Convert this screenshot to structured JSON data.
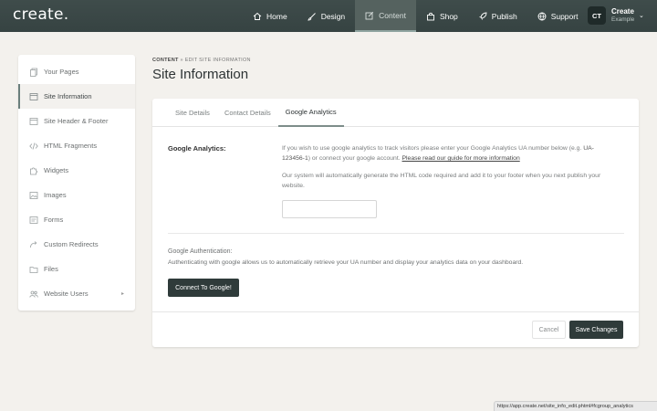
{
  "app": {
    "logo": "create."
  },
  "nav": {
    "items": [
      {
        "label": "Home",
        "icon": "home-icon"
      },
      {
        "label": "Design",
        "icon": "brush-icon"
      },
      {
        "label": "Content",
        "icon": "edit-icon",
        "active": true
      },
      {
        "label": "Shop",
        "icon": "shop-icon"
      },
      {
        "label": "Publish",
        "icon": "rocket-icon"
      },
      {
        "label": "Support",
        "icon": "globe-icon"
      }
    ]
  },
  "account": {
    "initials": "CT",
    "name": "Create",
    "sub": "Example"
  },
  "sidebar": {
    "items": [
      {
        "label": "Your Pages",
        "icon": "pages-icon"
      },
      {
        "label": "Site Information",
        "icon": "browser-icon",
        "active": true
      },
      {
        "label": "Site Header & Footer",
        "icon": "browser-icon"
      },
      {
        "label": "HTML Fragments",
        "icon": "code-icon"
      },
      {
        "label": "Widgets",
        "icon": "puzzle-icon"
      },
      {
        "label": "Images",
        "icon": "image-icon"
      },
      {
        "label": "Forms",
        "icon": "form-icon"
      },
      {
        "label": "Custom Redirects",
        "icon": "redirect-icon"
      },
      {
        "label": "Files",
        "icon": "folder-icon"
      },
      {
        "label": "Website Users",
        "icon": "users-icon"
      }
    ]
  },
  "breadcrumb": {
    "first": "CONTENT",
    "sep": "»",
    "second": "EDIT SITE INFORMATION"
  },
  "page": {
    "title": "Site Information"
  },
  "tabs": [
    {
      "label": "Site Details"
    },
    {
      "label": "Contact Details"
    },
    {
      "label": "Google Analytics",
      "active": true
    }
  ],
  "form": {
    "ga_label": "Google Analytics:",
    "ga_text_before": "If you wish to use google analytics to track visitors please enter your Google Analytics UA number below (e.g. ",
    "ga_example": "UA-123456-1",
    "ga_text_after": ") or connect your google account. ",
    "ga_link": "Please read our guide for more information",
    "ga_text2": "Our system will automatically generate the HTML code required and add it to your footer when you next publish your website.",
    "ua_value": "",
    "auth_title": "Google Authentication:",
    "auth_text": "Authenticating with google allows us to automatically retrieve your UA number and display your analytics data on your dashboard.",
    "connect_label": "Connect To Google!"
  },
  "footer": {
    "cancel_label": "Cancel",
    "save_label": "Save Changes"
  },
  "status_bar": {
    "url": "https://app.create.net/site_info_edit.phtml#fcgroup_analytics"
  }
}
